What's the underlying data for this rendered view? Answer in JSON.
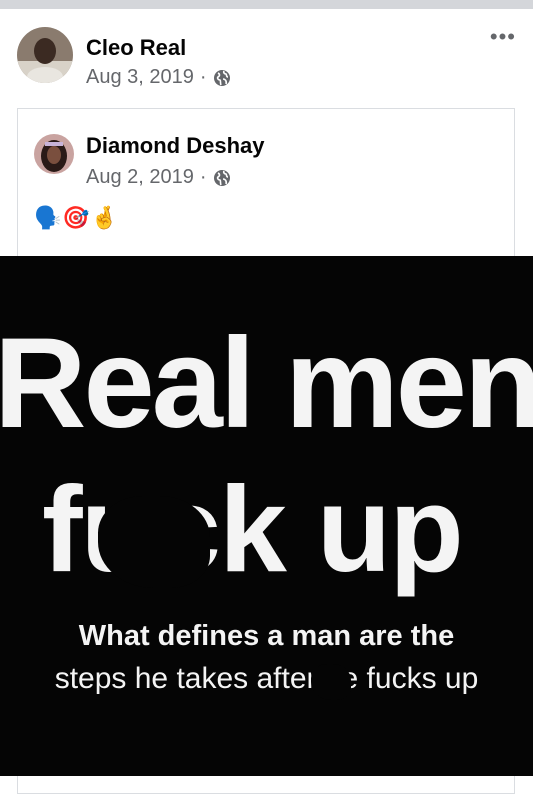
{
  "post": {
    "author": "Cleo Real",
    "date": "Aug 3, 2019",
    "audience_icon": "globe-icon",
    "more_label": "•••"
  },
  "shared": {
    "author": "Diamond Deshay",
    "date": "Aug 2, 2019",
    "audience_icon": "globe-icon",
    "emojis": "🗣️🎯🤞"
  },
  "meme": {
    "line1": "Real men",
    "line2": "fuck up",
    "line3": "What defines a man are the",
    "line4": "steps he takes after he fucks up"
  },
  "colors": {
    "meme_background": "#050505",
    "meme_text": "#f4f4f4",
    "secondary_text": "#65676b"
  }
}
